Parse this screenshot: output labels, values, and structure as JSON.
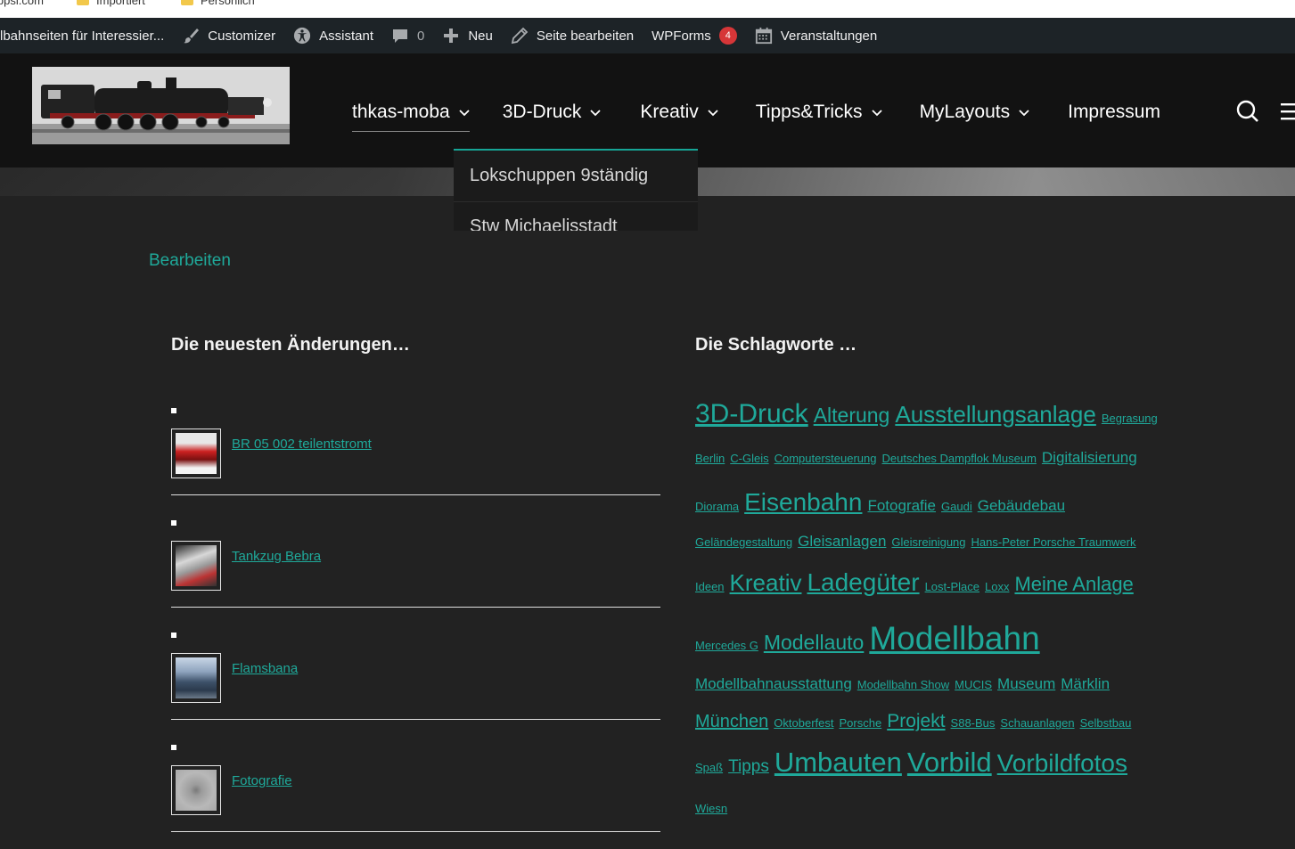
{
  "browser": {
    "bookmarks": [
      "ippsi.com",
      "Importiert",
      "Persönlich"
    ]
  },
  "adminbar": {
    "site": "lbahnseiten für Interessier...",
    "customizer": "Customizer",
    "assistant": "Assistant",
    "comments_count": "0",
    "new": "Neu",
    "edit_page": "Seite bearbeiten",
    "wpforms": "WPForms",
    "wpforms_badge": "4",
    "events": "Veranstaltungen"
  },
  "nav": {
    "items": [
      {
        "label": "thkas-moba",
        "has_submenu": true,
        "active": true
      },
      {
        "label": "3D-Druck",
        "has_submenu": true
      },
      {
        "label": "Kreativ",
        "has_submenu": true
      },
      {
        "label": "Tipps&Tricks",
        "has_submenu": true
      },
      {
        "label": "MyLayouts",
        "has_submenu": true
      },
      {
        "label": "Impressum",
        "has_submenu": false
      }
    ],
    "dropdown": [
      "Lokschuppen 9ständig",
      "Stw Michaelisstadt"
    ]
  },
  "content": {
    "edit_link": "Bearbeiten",
    "recent_title": "Die neuesten Änderungen…",
    "tags_title": "Die Schlagworte …",
    "recent_posts": [
      {
        "title": "BR 05 002 teilentstromt"
      },
      {
        "title": "Tankzug Bebra"
      },
      {
        "title": "Flamsbana"
      },
      {
        "title": "Fotografie"
      }
    ],
    "tag_lines": [
      {
        "tags": [
          {
            "t": "3D-Druck",
            "s": 30
          },
          {
            "t": "Alterung",
            "s": 23
          },
          {
            "t": "Ausstellungsanlage",
            "s": 26
          },
          {
            "t": "Begrasung",
            "s": 13
          }
        ]
      },
      {
        "tags": [
          {
            "t": "Berlin",
            "s": 13
          },
          {
            "t": "C-Gleis",
            "s": 13
          },
          {
            "t": "Computersteuerung",
            "s": 13
          },
          {
            "t": "Deutsches Dampflok Museum",
            "s": 13
          },
          {
            "t": "Digitalisierung",
            "s": 17
          }
        ]
      },
      {
        "tags": [
          {
            "t": "Diorama",
            "s": 13
          },
          {
            "t": "Eisenbahn",
            "s": 28
          },
          {
            "t": "Fotografie",
            "s": 17
          },
          {
            "t": "Gaudi",
            "s": 13
          },
          {
            "t": "Gebäudebau",
            "s": 17
          }
        ]
      },
      {
        "tags": [
          {
            "t": "Geländegestaltung",
            "s": 13
          },
          {
            "t": "Gleisanlagen",
            "s": 17
          },
          {
            "t": "Gleisreinigung",
            "s": 13
          },
          {
            "t": "Hans-Peter Porsche Traumwerk",
            "s": 13
          }
        ]
      },
      {
        "tags": [
          {
            "t": "Ideen",
            "s": 13
          },
          {
            "t": "Kreativ",
            "s": 26
          },
          {
            "t": "Ladegüter",
            "s": 28
          },
          {
            "t": "Lost-Place",
            "s": 13
          },
          {
            "t": "Loxx",
            "s": 13
          },
          {
            "t": "Meine Anlage",
            "s": 22
          }
        ]
      },
      {
        "tags": [
          {
            "t": "Mercedes G",
            "s": 13
          },
          {
            "t": "Modellauto",
            "s": 23
          },
          {
            "t": "Modellbahn",
            "s": 37
          }
        ]
      },
      {
        "tags": [
          {
            "t": "Modellbahnausstattung",
            "s": 17
          },
          {
            "t": "Modellbahn Show",
            "s": 13
          },
          {
            "t": "MUCIS",
            "s": 13
          },
          {
            "t": "Museum",
            "s": 17
          },
          {
            "t": "Märklin",
            "s": 17
          }
        ]
      },
      {
        "tags": [
          {
            "t": "München",
            "s": 20
          },
          {
            "t": "Oktoberfest",
            "s": 13
          },
          {
            "t": "Porsche",
            "s": 13
          },
          {
            "t": "Projekt",
            "s": 21
          },
          {
            "t": "S88-Bus",
            "s": 13
          },
          {
            "t": "Schauanlagen",
            "s": 13
          },
          {
            "t": "Selbstbau",
            "s": 13
          }
        ]
      },
      {
        "tags": [
          {
            "t": "Spaß",
            "s": 13
          },
          {
            "t": "Tipps",
            "s": 19
          },
          {
            "t": "Umbauten",
            "s": 31
          },
          {
            "t": "Vorbild",
            "s": 31
          },
          {
            "t": "Vorbildfotos",
            "s": 28
          }
        ]
      },
      {
        "tags": [
          {
            "t": "Wiesn",
            "s": 13
          }
        ]
      }
    ]
  },
  "colors": {
    "accent": "#1fa99a",
    "adminbar": "#1d2327",
    "background": "#222222",
    "badge": "#d63638"
  }
}
